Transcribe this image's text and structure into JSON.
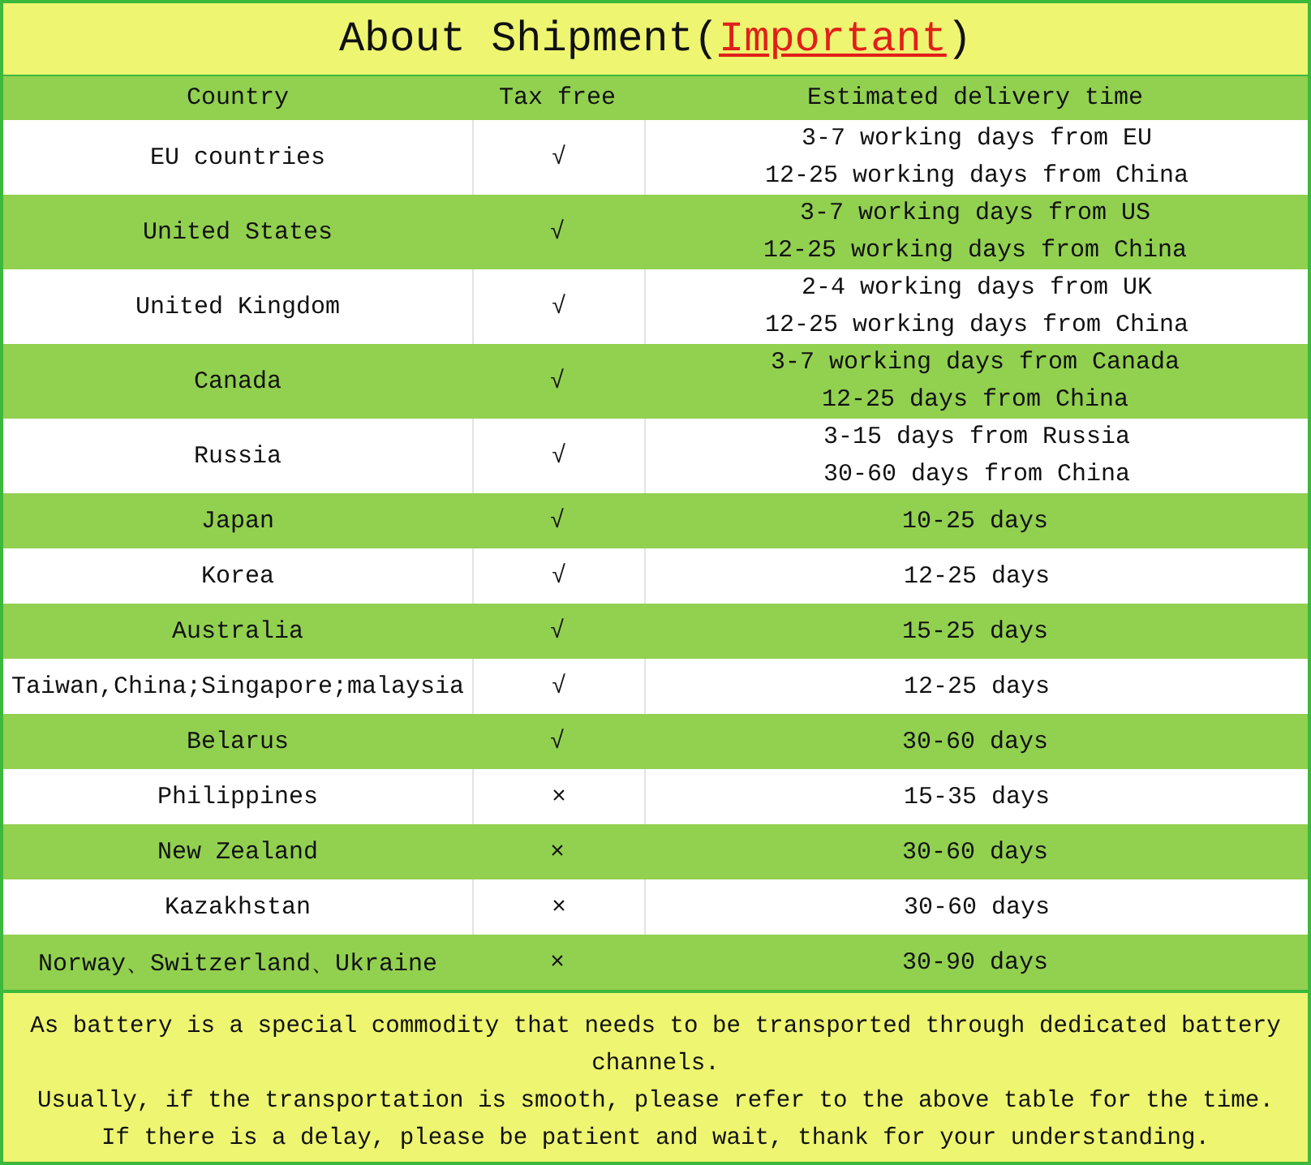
{
  "title": [
    {
      "kind": "plain",
      "text": "About Shipment("
    },
    {
      "kind": "highlight",
      "text": "Important"
    },
    {
      "kind": "plain",
      "text": ")"
    }
  ],
  "table": {
    "columns": [
      "Country",
      "Tax free",
      "Estimated delivery time"
    ],
    "rows": [
      {
        "country": "EU countries",
        "tax_free": "√",
        "delivery": [
          "3-7 working days from EU",
          "12-25 working days from China"
        ]
      },
      {
        "country": "United States",
        "tax_free": "√",
        "delivery": [
          "3-7 working days from US",
          "12-25 working days from China"
        ]
      },
      {
        "country": "United Kingdom",
        "tax_free": "√",
        "delivery": [
          "2-4 working days from UK",
          "12-25 working days from China"
        ]
      },
      {
        "country": "Canada",
        "tax_free": "√",
        "delivery": [
          "3-7 working days from Canada",
          "12-25 days from China"
        ]
      },
      {
        "country": "Russia",
        "tax_free": "√",
        "delivery": [
          "3-15 days from Russia",
          "30-60 days from China"
        ]
      },
      {
        "country": "Japan",
        "tax_free": "√",
        "delivery": [
          "10-25 days"
        ]
      },
      {
        "country": "Korea",
        "tax_free": "√",
        "delivery": [
          "12-25 days"
        ]
      },
      {
        "country": "Australia",
        "tax_free": "√",
        "delivery": [
          "15-25 days"
        ]
      },
      {
        "country": "Taiwan,China;Singapore;malaysia",
        "tax_free": "√",
        "delivery": [
          "12-25 days"
        ]
      },
      {
        "country": "Belarus",
        "tax_free": "√",
        "delivery": [
          "30-60 days"
        ]
      },
      {
        "country": "Philippines",
        "tax_free": "×",
        "delivery": [
          "15-35 days"
        ]
      },
      {
        "country": "New Zealand",
        "tax_free": "×",
        "delivery": [
          "30-60 days"
        ]
      },
      {
        "country": "Kazakhstan",
        "tax_free": "×",
        "delivery": [
          "30-60 days"
        ]
      },
      {
        "country": "Norway、Switzerland、Ukraine",
        "tax_free": "×",
        "delivery": [
          "30-90 days"
        ]
      }
    ]
  },
  "notes": [
    "As battery is a special commodity that needs to be transported through dedicated battery channels.",
    "Usually, if the transportation is smooth, please refer to the above table for the time.",
    "If there is a delay, please be patient and wait, thank for your understanding."
  ]
}
